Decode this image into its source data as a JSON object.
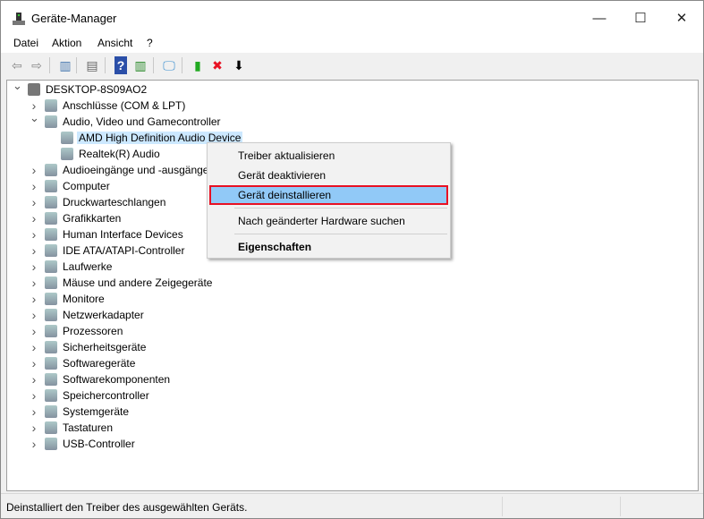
{
  "window": {
    "title": "Geräte-Manager",
    "controls": [
      "minimize",
      "maximize",
      "close"
    ]
  },
  "menu": [
    "Datei",
    "Aktion",
    "Ansicht",
    "?"
  ],
  "toolbar": [
    {
      "icon": "back-arrow-icon",
      "glyph": "⇦",
      "color": "#888"
    },
    {
      "icon": "forward-arrow-icon",
      "glyph": "⇨",
      "color": "#888"
    },
    {
      "icon": "console-tree-icon",
      "glyph": "▥",
      "color": "#4a7ab0"
    },
    {
      "icon": "properties-icon",
      "glyph": "▤",
      "color": "#666"
    },
    {
      "icon": "help-icon",
      "glyph": "?",
      "color": "#fff",
      "bg": "#2b4fa8"
    },
    {
      "icon": "action-pane-icon",
      "glyph": "▥",
      "color": "#2a8a2a"
    },
    {
      "icon": "scan-hardware-icon",
      "glyph": "🖵",
      "color": "#3a8fd0"
    },
    {
      "icon": "update-driver-icon",
      "glyph": "▮",
      "color": "#2a2"
    },
    {
      "icon": "uninstall-icon",
      "glyph": "✖",
      "color": "#e81123"
    },
    {
      "icon": "download-icon",
      "glyph": "⬇",
      "color": "#000"
    }
  ],
  "tree": [
    {
      "label": "DESKTOP-8S09AO2",
      "level": 0,
      "expanded": true,
      "icon": "computer-icon"
    },
    {
      "label": "Anschlüsse (COM & LPT)",
      "level": 1,
      "expanded": false,
      "icon": "port-icon"
    },
    {
      "label": "Audio, Video und Gamecontroller",
      "level": 1,
      "expanded": true,
      "icon": "speaker-icon"
    },
    {
      "label": "AMD High Definition Audio Device",
      "level": 2,
      "selected": true,
      "icon": "speaker-icon"
    },
    {
      "label": "Realtek(R) Audio",
      "level": 2,
      "icon": "speaker-icon"
    },
    {
      "label": "Audioeingänge und -ausgänge",
      "level": 1,
      "expanded": false,
      "icon": "audio-io-icon"
    },
    {
      "label": "Computer",
      "level": 1,
      "expanded": false,
      "icon": "monitor-icon"
    },
    {
      "label": "Druckwarteschlangen",
      "level": 1,
      "expanded": false,
      "icon": "printer-icon"
    },
    {
      "label": "Grafikkarten",
      "level": 1,
      "expanded": false,
      "icon": "display-adapter-icon"
    },
    {
      "label": "Human Interface Devices",
      "level": 1,
      "expanded": false,
      "icon": "hid-icon"
    },
    {
      "label": "IDE ATA/ATAPI-Controller",
      "level": 1,
      "expanded": false,
      "icon": "ide-icon"
    },
    {
      "label": "Laufwerke",
      "level": 1,
      "expanded": false,
      "icon": "drive-icon"
    },
    {
      "label": "Mäuse und andere Zeigegeräte",
      "level": 1,
      "expanded": false,
      "icon": "mouse-icon"
    },
    {
      "label": "Monitore",
      "level": 1,
      "expanded": false,
      "icon": "monitor-icon"
    },
    {
      "label": "Netzwerkadapter",
      "level": 1,
      "expanded": false,
      "icon": "network-icon"
    },
    {
      "label": "Prozessoren",
      "level": 1,
      "expanded": false,
      "icon": "processor-icon"
    },
    {
      "label": "Sicherheitsgeräte",
      "level": 1,
      "expanded": false,
      "icon": "security-icon"
    },
    {
      "label": "Softwaregeräte",
      "level": 1,
      "expanded": false,
      "icon": "software-device-icon"
    },
    {
      "label": "Softwarekomponenten",
      "level": 1,
      "expanded": false,
      "icon": "software-component-icon"
    },
    {
      "label": "Speichercontroller",
      "level": 1,
      "expanded": false,
      "icon": "storage-icon"
    },
    {
      "label": "Systemgeräte",
      "level": 1,
      "expanded": false,
      "icon": "system-icon"
    },
    {
      "label": "Tastaturen",
      "level": 1,
      "expanded": false,
      "icon": "keyboard-icon"
    },
    {
      "label": "USB-Controller",
      "level": 1,
      "expanded": false,
      "icon": "usb-icon"
    }
  ],
  "context_menu": [
    {
      "label": "Treiber aktualisieren"
    },
    {
      "label": "Gerät deaktivieren"
    },
    {
      "label": "Gerät deinstallieren",
      "highlighted": true
    },
    {
      "separator": true
    },
    {
      "label": "Nach geänderter Hardware suchen"
    },
    {
      "separator": true
    },
    {
      "label": "Eigenschaften",
      "bold": true
    }
  ],
  "status": {
    "text": "Deinstalliert den Treiber des ausgewählten Geräts."
  },
  "colors": {
    "highlight": "#91c9f7",
    "highlight_border": "#e81123",
    "selection": "#cce8ff"
  }
}
